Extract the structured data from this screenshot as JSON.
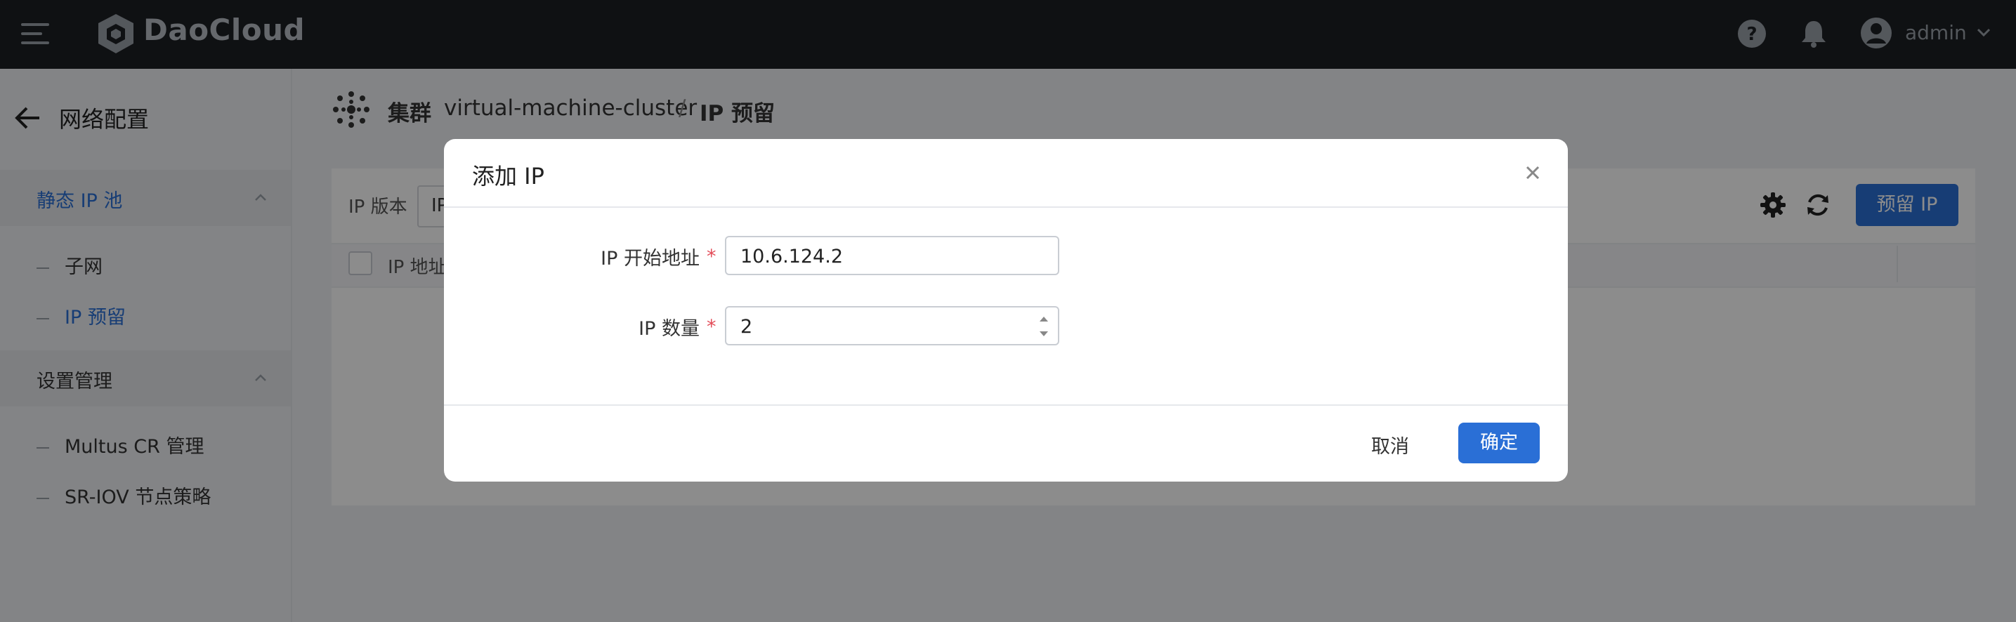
{
  "header": {
    "brand": "DaoCloud",
    "username": "admin",
    "icons": [
      "menu-icon",
      "help-icon",
      "bell-icon",
      "user-avatar-icon",
      "chevron-down-icon"
    ]
  },
  "sidebar": {
    "title": "网络配置",
    "groups": [
      {
        "label": "静态 IP 池",
        "items": [
          {
            "label": "子网"
          },
          {
            "label": "IP 预留"
          }
        ]
      },
      {
        "label": "设置管理",
        "items": [
          {
            "label": "Multus CR 管理"
          },
          {
            "label": "SR-IOV 节点策略"
          }
        ]
      }
    ]
  },
  "breadcrumb": {
    "cluster_label": "集群",
    "cluster_name": "virtual-machine-cluster",
    "separator": "/",
    "current": "IP 预留"
  },
  "toolbar": {
    "filter_label": "IP 版本",
    "filter_value": "IP",
    "reserve_button": "预留 IP"
  },
  "table": {
    "columns": [
      "IP 地址"
    ]
  },
  "modal": {
    "title": "添加 IP",
    "fields": [
      {
        "label": "IP 开始地址",
        "required": "*",
        "value": "10.6.124.2"
      },
      {
        "label": "IP 数量",
        "required": "*",
        "value": "2"
      }
    ],
    "cancel": "取消",
    "confirm": "确定"
  },
  "colors": {
    "accent": "#2a6fd6",
    "topbar": "#1c1f24",
    "required": "#e34d59"
  }
}
